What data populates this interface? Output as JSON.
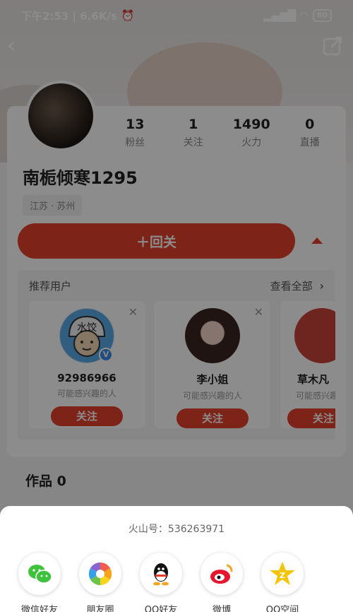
{
  "status_bar": {
    "time_speed": "下午2:53 | 6.6K/s",
    "battery": "80"
  },
  "profile": {
    "nickname": "南栀倾寒1295",
    "location": "江苏 · 苏州",
    "stats": [
      {
        "value": "13",
        "label": "粉丝"
      },
      {
        "value": "1",
        "label": "关注"
      },
      {
        "value": "1490",
        "label": "火力"
      },
      {
        "value": "0",
        "label": "直播"
      }
    ],
    "follow_back_label": "＋回关"
  },
  "recommend": {
    "title": "推荐用户",
    "view_all": "查看全部",
    "users": [
      {
        "name": "92986966",
        "reason": "可能感兴趣的人",
        "follow_label": "关注",
        "avatar_text": "水饺"
      },
      {
        "name": "李小姐",
        "reason": "可能感兴趣的人",
        "follow_label": "关注"
      },
      {
        "name": "草木凡",
        "reason": "可能感兴趣的人",
        "follow_label": "关注"
      }
    ]
  },
  "works": {
    "label": "作品 0"
  },
  "share": {
    "id_text": "火山号：536263971",
    "targets": [
      {
        "label": "微信好友",
        "icon": "wechat-icon"
      },
      {
        "label": "朋友圈",
        "icon": "moments-icon"
      },
      {
        "label": "QQ好友",
        "icon": "qq-icon"
      },
      {
        "label": "微博",
        "icon": "weibo-icon"
      },
      {
        "label": "QQ空间",
        "icon": "qzone-icon"
      }
    ]
  },
  "colors": {
    "accent": "#e6402b",
    "verify": "#3d8ce5"
  }
}
